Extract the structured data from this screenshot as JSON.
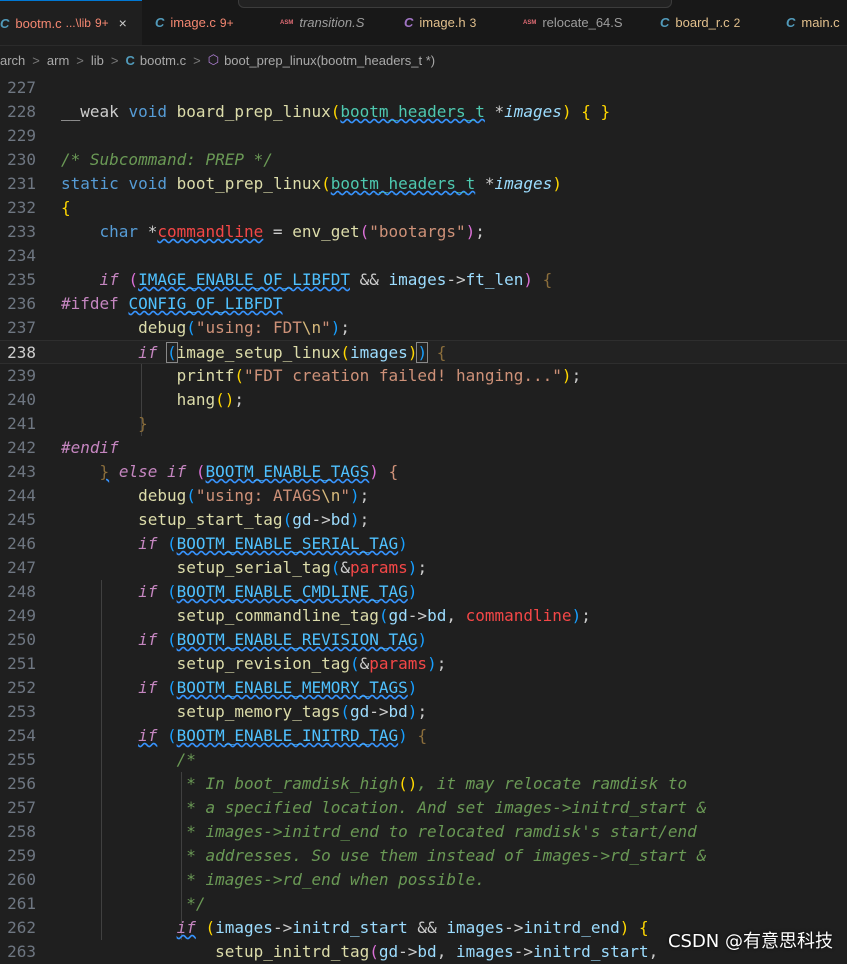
{
  "tabs": [
    {
      "icon": "C",
      "name": "bootm.c",
      "detail": "...\\lib",
      "count": "9+",
      "active": true,
      "status": "err",
      "closable": true
    },
    {
      "icon": "C",
      "name": "image.c",
      "detail": "",
      "count": "9+",
      "active": false,
      "status": "err"
    },
    {
      "icon": "ASM",
      "name": "transition.S",
      "detail": "",
      "count": "",
      "active": false,
      "status": "it"
    },
    {
      "icon": "C",
      "name": "image.h",
      "detail": "",
      "count": "3",
      "active": false,
      "status": "warn"
    },
    {
      "icon": "ASM",
      "name": "relocate_64.S",
      "detail": "",
      "count": "",
      "active": false,
      "status": ""
    },
    {
      "icon": "C",
      "name": "board_r.c",
      "detail": "",
      "count": "2",
      "active": false,
      "status": "warn"
    },
    {
      "icon": "C",
      "name": "main.c",
      "detail": "",
      "count": "",
      "active": false,
      "status": "warn"
    }
  ],
  "close_glyph": "×",
  "breadcrumb": {
    "items": [
      "arch",
      "arm",
      "lib"
    ],
    "separator": ">",
    "file_icon": "C",
    "file": "bootm.c",
    "symbol_icon": "⬡",
    "symbol": "boot_prep_linux(bootm_headers_t *)"
  },
  "editor": {
    "current_line": "238",
    "lines": [
      {
        "n": "227",
        "html": ""
      },
      {
        "n": "228",
        "html": "__weak <span class='k'>void</span> <span class='f'>board_prep_linux</span><span class='b1'>(</span><span class='t sq'>bootm_headers_t</span> *<span class='vi'>images</span><span class='b1'>)</span> <span class='b1'>{</span> <span class='b1'>}</span>"
      },
      {
        "n": "229",
        "html": ""
      },
      {
        "n": "230",
        "html": "<span class='c'>/* Subcommand: PREP */</span>"
      },
      {
        "n": "231",
        "html": "<span class='k'>static</span> <span class='k'>void</span> <span class='f'>boot_prep_linux</span><span class='b1'>(</span><span class='t sq'>bootm_headers_t</span> *<span class='vi'>images</span><span class='b1'>)</span>"
      },
      {
        "n": "232",
        "html": "<span class='b1'>{</span>"
      },
      {
        "n": "233",
        "html": "    <span class='k'>char</span> *<span class='p sq'>commandline</span> = <span class='f'>env_get</span><span class='b2'>(</span><span class='s'>\"bootargs\"</span><span class='b2'>)</span>;"
      },
      {
        "n": "234",
        "html": ""
      },
      {
        "n": "235",
        "html": "    <span class='ki'>if</span> <span class='b2'>(</span><span class='m sq'>IMAGE_ENABLE_OF_LIBFDT</span> &amp;&amp; <span class='v'>images</span>-&gt;<span class='v'>ft_len</span><span class='b2'>)</span> <span class='b2' style='color:#8a6d3b'>{</span>"
      },
      {
        "n": "236",
        "html": "<span class='pp'>#ifdef</span> <span class='m sq'>CONFIG_OF_LIBFDT</span>"
      },
      {
        "n": "237",
        "html": "        <span class='f'>debug</span><span class='b3'>(</span><span class='s'>\"using: FDT</span><span class='e'>\\n</span><span class='s'>\"</span><span class='b3'>)</span>;"
      },
      {
        "n": "238",
        "html": "        <span class='ki'>if</span> <span class='b3' style='outline:1px solid #888'>(</span><span class='f'>image_setup_linux</span><span class='b1'>(</span><span class='v'>images</span><span class='b1'>)</span><span class='b3' style='outline:1px solid #888'>)</span> <span class='b3' style='color:#8a6d3b'>{</span>"
      },
      {
        "n": "239",
        "html": "            <span class='f'>printf</span><span class='b1'>(</span><span class='s'>\"FDT creation failed! hanging...\"</span><span class='b1'>)</span>;"
      },
      {
        "n": "240",
        "html": "            <span class='f'>hang</span><span class='b1'>()</span>;"
      },
      {
        "n": "241",
        "html": "        <span style='color:#8a6d3b'>}</span>"
      },
      {
        "n": "242",
        "html": "<span class='ki'>#endif</span>"
      },
      {
        "n": "243",
        "html": "    <span class='b2 sq' style='color:#8a6d3b'>}</span> <span class='ki'>else</span> <span class='ki'>if</span> <span class='b2'>(</span><span class='m sq'>BOOTM_ENABLE_TAGS</span><span class='b2'>)</span> <span class='b2' style='color:#ce9178'>{</span>"
      },
      {
        "n": "244",
        "html": "        <span class='f'>debug</span><span class='b3'>(</span><span class='s'>\"using: ATAGS</span><span class='e'>\\n</span><span class='s'>\"</span><span class='b3'>)</span>;"
      },
      {
        "n": "245",
        "html": "        <span class='f'>setup_start_tag</span><span class='b3'>(</span><span class='v'>gd</span>-&gt;<span class='v'>bd</span><span class='b3'>)</span>;"
      },
      {
        "n": "246",
        "html": "        <span class='ki'>if</span> <span class='b3'>(</span><span class='m sq'>BOOTM_ENABLE_SERIAL_TAG</span><span class='b3'>)</span>"
      },
      {
        "n": "247",
        "html": "            <span class='f'>setup_serial_tag</span><span class='b3'>(</span>&amp;<span class='p'>params</span><span class='b3'>)</span>;"
      },
      {
        "n": "248",
        "html": "        <span class='ki'>if</span> <span class='b3'>(</span><span class='m sq'>BOOTM_ENABLE_CMDLINE_TAG</span><span class='b3'>)</span>"
      },
      {
        "n": "249",
        "html": "            <span class='f'>setup_commandline_tag</span><span class='b3'>(</span><span class='v'>gd</span>-&gt;<span class='v'>bd</span>, <span class='p'>commandline</span><span class='b3'>)</span>;"
      },
      {
        "n": "250",
        "html": "        <span class='ki'>if</span> <span class='b3'>(</span><span class='m sq'>BOOTM_ENABLE_REVISION_TAG</span><span class='b3'>)</span>"
      },
      {
        "n": "251",
        "html": "            <span class='f'>setup_revision_tag</span><span class='b3'>(</span>&amp;<span class='p'>params</span><span class='b3'>)</span>;"
      },
      {
        "n": "252",
        "html": "        <span class='ki'>if</span> <span class='b3'>(</span><span class='m sq'>BOOTM_ENABLE_MEMORY_TAGS</span><span class='b3'>)</span>"
      },
      {
        "n": "253",
        "html": "            <span class='f'>setup_memory_tags</span><span class='b3'>(</span><span class='v'>gd</span>-&gt;<span class='v'>bd</span><span class='b3'>)</span>;"
      },
      {
        "n": "254",
        "html": "        <span class='ki sq'>if</span> <span class='b3'>(</span><span class='m sq'>BOOTM_ENABLE_INITRD_TAG</span><span class='b3'>)</span> <span style='color:#8a6d3b'>{</span>"
      },
      {
        "n": "255",
        "html": "            <span class='c'>/*</span>"
      },
      {
        "n": "256",
        "html": "<span class='c'>             * In boot_ramdisk_high</span><span class='b1'>()</span><span class='c'>, it may relocate ramdisk to</span>"
      },
      {
        "n": "257",
        "html": "<span class='c'>             * a specified location. And set images-&gt;initrd_start &amp;</span>"
      },
      {
        "n": "258",
        "html": "<span class='c'>             * images-&gt;initrd_end to relocated ramdisk's start/end</span>"
      },
      {
        "n": "259",
        "html": "<span class='c'>             * addresses. So use them instead of images-&gt;rd_start &amp;</span>"
      },
      {
        "n": "260",
        "html": "<span class='c'>             * images-&gt;rd_end when possible.</span>"
      },
      {
        "n": "261",
        "html": "<span class='c'>             */</span>"
      },
      {
        "n": "262",
        "html": "            <span class='ki sq'>if</span> <span class='b1'>(</span><span class='v'>images</span>-&gt;<span class='v'>initrd_start</span> &amp;&amp; <span class='v'>images</span>-&gt;<span class='v'>initrd_end</span><span class='b1'>)</span> <span class='b1'>{</span>"
      },
      {
        "n": "263",
        "html": "                <span class='f'>setup_initrd_tag</span><span class='b2'>(</span><span class='v'>gd</span>-&gt;<span class='v'>bd</span>, <span class='v'>images</span>-&gt;<span class='v'>initrd_start</span>,"
      }
    ]
  },
  "watermark": "CSDN @有意思科技"
}
